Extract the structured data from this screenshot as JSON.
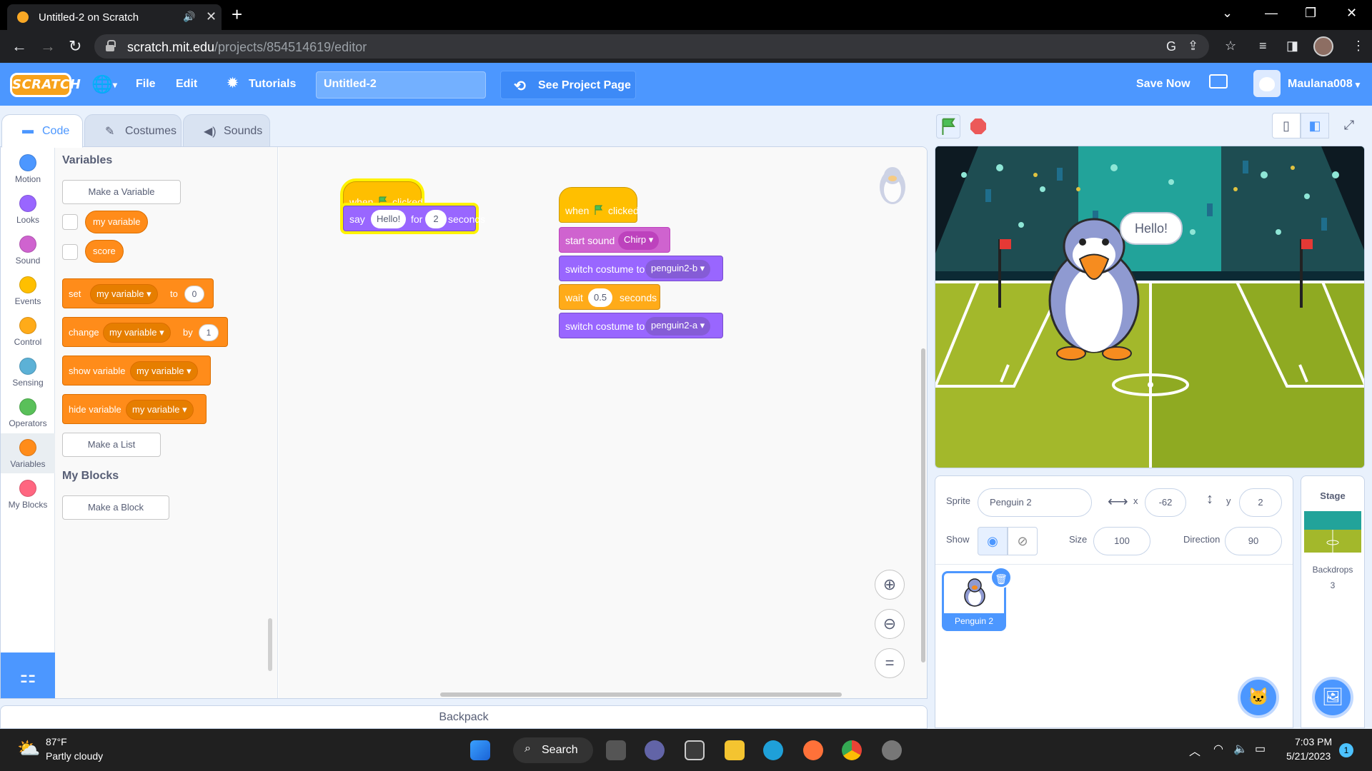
{
  "browser": {
    "tab_title": "Untitled-2 on Scratch",
    "url_host": "scratch.mit.edu",
    "url_path": "/projects/854514619/editor"
  },
  "menubar": {
    "logo": "SCRATCH",
    "file": "File",
    "edit": "Edit",
    "tutorials": "Tutorials",
    "project_title": "Untitled-2",
    "see_project_page": "See Project Page",
    "save_now": "Save Now",
    "username": "Maulana008"
  },
  "tabs": {
    "code": "Code",
    "costumes": "Costumes",
    "sounds": "Sounds"
  },
  "categories": [
    {
      "label": "Motion",
      "color": "#4c97ff"
    },
    {
      "label": "Looks",
      "color": "#9966ff"
    },
    {
      "label": "Sound",
      "color": "#cf63cf"
    },
    {
      "label": "Events",
      "color": "#ffbf00"
    },
    {
      "label": "Control",
      "color": "#ffab19"
    },
    {
      "label": "Sensing",
      "color": "#5cb1d6"
    },
    {
      "label": "Operators",
      "color": "#59c059"
    },
    {
      "label": "Variables",
      "color": "#ff8c1a"
    },
    {
      "label": "My Blocks",
      "color": "#ff6680"
    }
  ],
  "palette": {
    "variables_heading": "Variables",
    "make_variable": "Make a Variable",
    "var1": "my variable",
    "var2": "score",
    "set_block": {
      "verb": "set",
      "var": "my variable",
      "mid": "to",
      "value": "0"
    },
    "change_block": {
      "verb": "change",
      "var": "my variable",
      "mid": "by",
      "value": "1"
    },
    "show_block": {
      "verb": "show variable",
      "var": "my variable"
    },
    "hide_block": {
      "verb": "hide variable",
      "var": "my variable"
    },
    "make_list": "Make a List",
    "myblocks_heading": "My Blocks",
    "make_block": "Make a Block"
  },
  "script1": {
    "hat": {
      "when": "when",
      "clicked": "clicked"
    },
    "say": {
      "verb": "say",
      "text": "Hello!",
      "for": "for",
      "secs": "2",
      "unit": "seconds"
    }
  },
  "script2": {
    "hat": {
      "when": "when",
      "clicked": "clicked"
    },
    "sound": {
      "verb": "start sound",
      "value": "Chirp"
    },
    "costume1": {
      "verb": "switch costume to",
      "value": "penguin2-b"
    },
    "wait": {
      "verb": "wait",
      "value": "0.5",
      "unit": "seconds"
    },
    "costume2": {
      "verb": "switch costume to",
      "value": "penguin2-a"
    }
  },
  "backpack": "Backpack",
  "stage": {
    "speech": "Hello!"
  },
  "sprite_info": {
    "sprite_label": "Sprite",
    "sprite_name": "Penguin 2",
    "x_label": "x",
    "x": "-62",
    "y_label": "y",
    "y": "2",
    "show_label": "Show",
    "size_label": "Size",
    "size": "100",
    "direction_label": "Direction",
    "direction": "90",
    "tile_name": "Penguin 2"
  },
  "stage_pane": {
    "title": "Stage",
    "backdrops_label": "Backdrops",
    "backdrops_count": "3"
  },
  "taskbar": {
    "temp": "87°F",
    "weather": "Partly cloudy",
    "search": "Search",
    "time": "7:03 PM",
    "date": "5/21/2023",
    "notif": "1"
  }
}
